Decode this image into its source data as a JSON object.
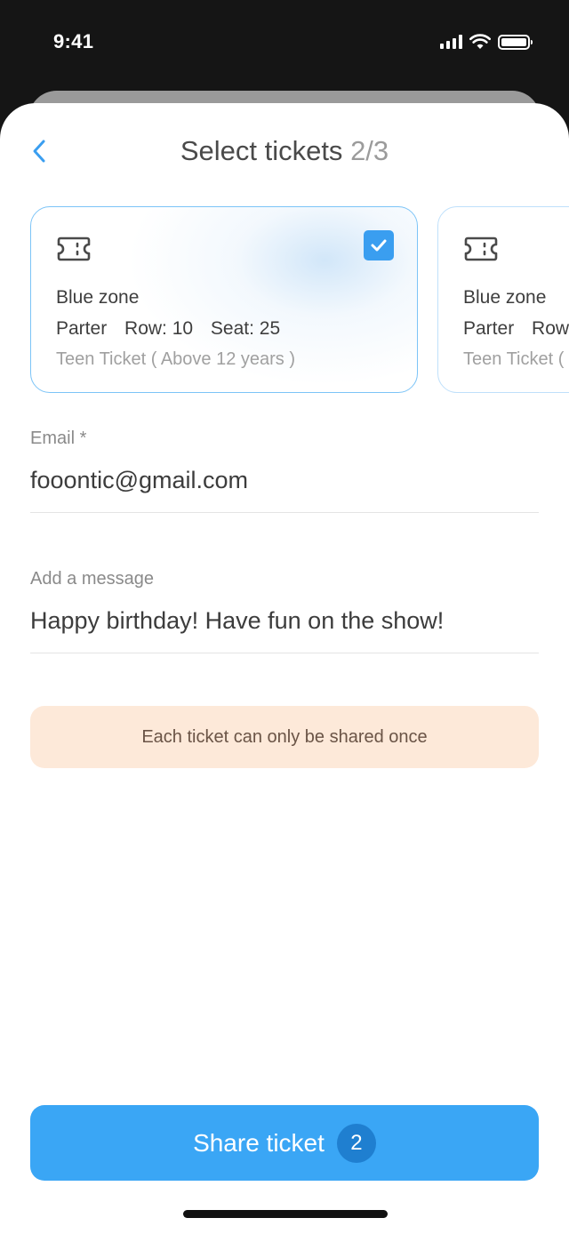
{
  "status_bar": {
    "time": "9:41"
  },
  "header": {
    "title": "Select tickets",
    "step": "2/3"
  },
  "tickets": [
    {
      "zone": "Blue zone",
      "area": "Parter",
      "row": "Row: 10",
      "seat": "Seat: 25",
      "type": "Teen Ticket ( Above 12 years )",
      "selected": true
    },
    {
      "zone": "Blue zone",
      "area": "Parter",
      "row": "Row:",
      "seat": "",
      "type": "Teen Ticket (",
      "selected": false
    }
  ],
  "email": {
    "label": "Email *",
    "value": "fooontic@gmail.com"
  },
  "message": {
    "label": "Add a message",
    "value": "Happy birthday! Have fun on the show!"
  },
  "notice": {
    "text": "Each ticket can only be shared once"
  },
  "share": {
    "label": "Share ticket",
    "count": "2"
  },
  "colors": {
    "accent": "#3aa6f5",
    "badge": "#1f7fd0",
    "notice_bg": "#fde9d9",
    "checkbox": "#3a9ef0"
  }
}
